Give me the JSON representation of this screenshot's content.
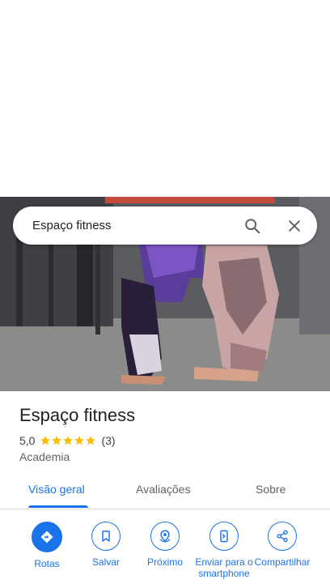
{
  "search": {
    "query": "Espaço fitness"
  },
  "place": {
    "name": "Espaço fitness",
    "rating": "5,0",
    "stars": 5,
    "review_count": "(3)",
    "category": "Academia"
  },
  "tabs": [
    {
      "label": "Visão geral",
      "active": true
    },
    {
      "label": "Avaliações",
      "active": false
    },
    {
      "label": "Sobre",
      "active": false
    }
  ],
  "actions": [
    {
      "label": "Rotas",
      "icon": "directions-icon"
    },
    {
      "label": "Salvar",
      "icon": "bookmark-icon"
    },
    {
      "label": "Próximo",
      "icon": "nearby-icon"
    },
    {
      "label": "Enviar para o smartphone",
      "icon": "send-to-phone-icon"
    },
    {
      "label": "Compartilhar",
      "icon": "share-icon"
    }
  ],
  "colors": {
    "accent": "#1a73e8",
    "star": "#fbbc04",
    "text": "#202124"
  }
}
